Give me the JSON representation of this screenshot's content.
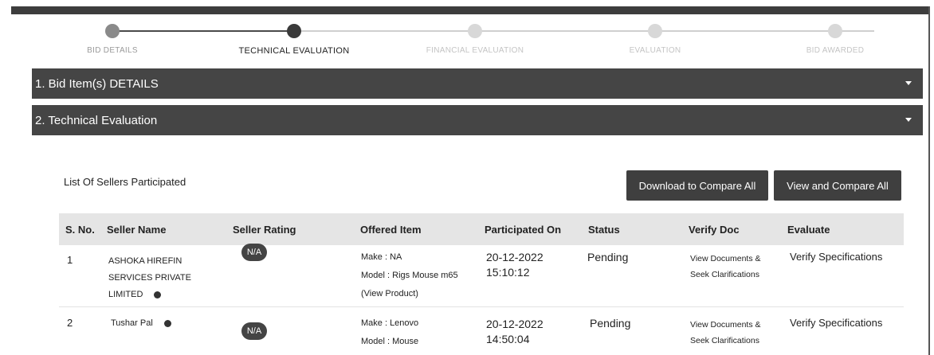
{
  "stepper": {
    "steps": [
      {
        "label": "BID DETAILS",
        "state": "done"
      },
      {
        "label": "TECHNICAL EVALUATION",
        "state": "current"
      },
      {
        "label": "FINANCIAL EVALUATION",
        "state": "todo"
      },
      {
        "label": "EVALUATION",
        "state": "todo"
      },
      {
        "label": "BID AWARDED",
        "state": "todo"
      }
    ]
  },
  "accordions": [
    {
      "title": "1. Bid Item(s) DETAILS"
    },
    {
      "title": "2. Technical Evaluation"
    }
  ],
  "sellers": {
    "title": "List Of Sellers Participated",
    "download_label": "Download to Compare All",
    "view_label": "View and Compare All",
    "columns": [
      "S. No.",
      "Seller Name",
      "Seller Rating",
      "Offered Item",
      "Participated On",
      "Status",
      "Verify Doc",
      "Evaluate"
    ],
    "rows": [
      {
        "sno": "1",
        "name_lines": [
          "ASHOKA HIREFIN",
          "SERVICES PRIVATE",
          "LIMITED"
        ],
        "rating": "N/A",
        "make": "Make : NA",
        "model": "Model : Rigs Mouse m65",
        "view_product": "(View Product)",
        "date": "20-12-2022",
        "time": "15:10:12",
        "status": "Pending",
        "verify_doc_1": "View Documents &",
        "verify_doc_2": "Seek Clarifications",
        "evaluate": "Verify Specifications"
      },
      {
        "sno": "2",
        "name_lines": [
          "Tushar Pal"
        ],
        "rating": "N/A",
        "make": "Make : Lenovo",
        "model": "Model : Mouse",
        "date": "20-12-2022",
        "time": "14:50:04",
        "status": "Pending",
        "verify_doc_1": "View Documents &",
        "verify_doc_2": "Seek Clarifications",
        "evaluate": "Verify Specifications"
      }
    ]
  },
  "colors": {
    "dark": "#454545",
    "header_bg": "#e5e5e5"
  },
  "icons": {
    "expand": "caret-down-icon",
    "info": "info-icon"
  }
}
